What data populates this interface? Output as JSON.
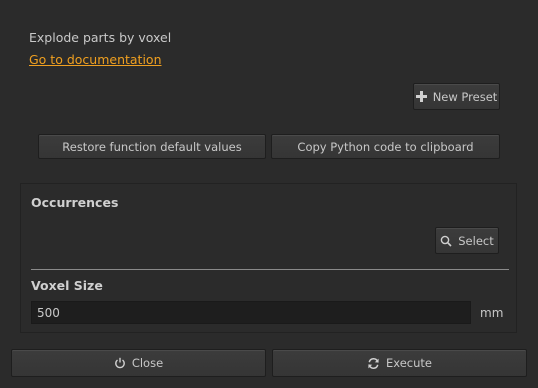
{
  "header": {
    "description": "Explode parts by voxel",
    "doc_link": "Go to documentation"
  },
  "toolbar": {
    "new_preset_label": "New Preset",
    "restore_label": "Restore function default values",
    "copy_label": "Copy Python code to clipboard"
  },
  "occurrences": {
    "title": "Occurrences",
    "select_label": "Select"
  },
  "voxel": {
    "title": "Voxel Size",
    "value": "500",
    "unit": "mm"
  },
  "footer": {
    "close_label": "Close",
    "execute_label": "Execute"
  },
  "colors": {
    "background": "#2b2b2b",
    "link": "#f0a020",
    "input_bg": "#1e1e1e"
  },
  "icons": {
    "new_preset": "plus-icon",
    "select": "search-icon",
    "close": "power-icon",
    "execute": "refresh-icon"
  }
}
